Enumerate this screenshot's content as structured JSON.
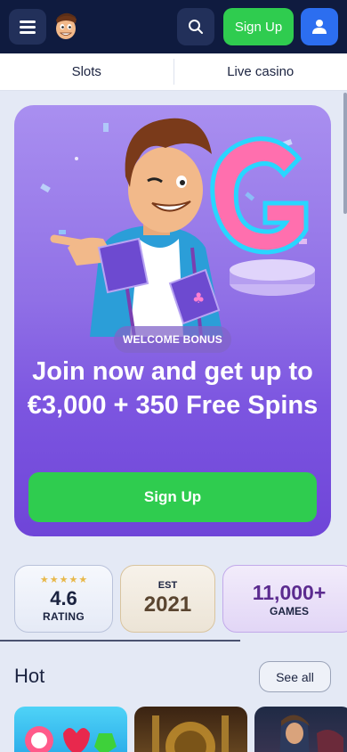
{
  "header": {
    "signup_label": "Sign Up",
    "icons": [
      "menu-icon",
      "mascot-logo",
      "search-icon",
      "user-icon"
    ]
  },
  "tabs": [
    {
      "label": "Slots"
    },
    {
      "label": "Live casino"
    }
  ],
  "hero": {
    "badge": "WELCOME BONUS",
    "title": "Join now and get up to €3,000 + 350 Free Spins",
    "signup_label": "Sign Up"
  },
  "stats": {
    "rating_value": "4.6",
    "rating_label": "RATING",
    "rating_stars": 5,
    "est_label": "EST",
    "est_year": "2021",
    "games_value": "11,000+",
    "games_label": "GAMES"
  },
  "hot": {
    "title": "Hot",
    "see_all": "See all"
  },
  "colors": {
    "header_bg": "#0f1b3f",
    "accent_green": "#2fcc4f",
    "accent_blue": "#2c6ef0",
    "hero_purple": "#7c55e0"
  }
}
